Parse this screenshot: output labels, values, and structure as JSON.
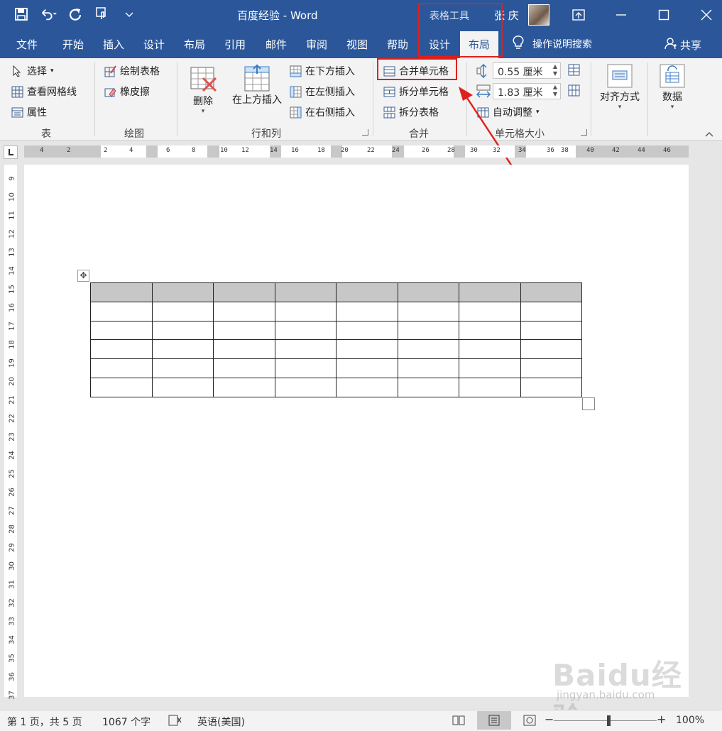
{
  "window": {
    "doc_title": "百度经验 - Word",
    "context_title": "表格工具",
    "user_name": "张 庆"
  },
  "tabs": [
    "文件",
    "开始",
    "插入",
    "设计",
    "布局",
    "引用",
    "邮件",
    "审阅",
    "视图",
    "帮助",
    "设计",
    "布局"
  ],
  "active_tab_index": 11,
  "tell_me": "操作说明搜索",
  "share": "共享",
  "ribbon": {
    "table_group": {
      "label": "表",
      "select": "选择",
      "view_gridlines": "查看网格线",
      "properties": "属性"
    },
    "draw_group": {
      "label": "绘图",
      "draw_table": "绘制表格",
      "eraser": "橡皮擦"
    },
    "rows_cols_group": {
      "label": "行和列",
      "delete": "删除",
      "insert_above": "在上方插入",
      "insert_below": "在下方插入",
      "insert_left": "在左侧插入",
      "insert_right": "在右侧插入"
    },
    "merge_group": {
      "label": "合并",
      "merge_cells": "合并单元格",
      "split_cells": "拆分单元格",
      "split_table": "拆分表格"
    },
    "cell_size_group": {
      "label": "单元格大小",
      "height": "0.55 厘米",
      "width": "1.83 厘米",
      "autofit": "自动调整"
    },
    "align_group": {
      "label": "对齐方式"
    },
    "data_group": {
      "label": "数据"
    }
  },
  "ruler": {
    "h_numbers": [
      "4",
      "2",
      "2",
      "4",
      "6",
      "8",
      "10",
      "12",
      "14",
      "16",
      "18",
      "20",
      "22",
      "24",
      "26",
      "28",
      "30",
      "32",
      "34",
      "36",
      "38",
      "40",
      "42",
      "44",
      "46"
    ],
    "v_numbers": [
      "9",
      "10",
      "11",
      "12",
      "13",
      "14",
      "15",
      "16",
      "17",
      "18",
      "19",
      "20",
      "21",
      "22",
      "23",
      "24",
      "25",
      "26",
      "27",
      "28",
      "29",
      "30",
      "31",
      "32",
      "33",
      "34",
      "35",
      "36",
      "37"
    ]
  },
  "table": {
    "rows": 6,
    "cols": 8
  },
  "status": {
    "page": "第 1 页，共 5 页",
    "words": "1067 个字",
    "language": "英语(美国)",
    "zoom": "100%"
  },
  "watermark": {
    "brand": "Baidu经验",
    "url": "jingyan.baidu.com"
  },
  "colors": {
    "title_bar": "#2b579a",
    "ribbon_bg": "#f3f3f3",
    "highlight_red": "#e0201c",
    "header_row": "#c7c7c7"
  }
}
